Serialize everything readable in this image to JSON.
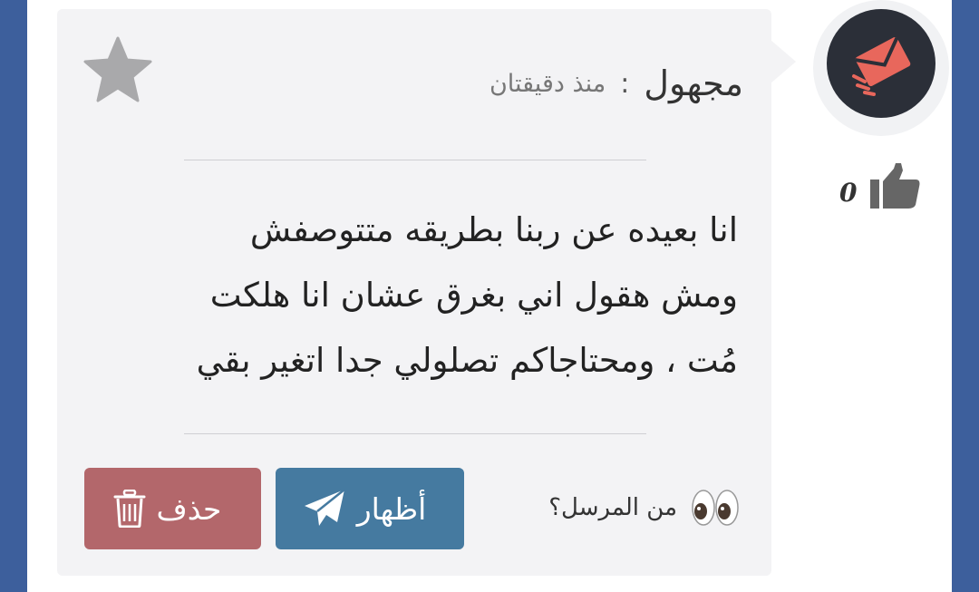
{
  "post": {
    "sender_name": "مجهول",
    "separator": ":",
    "time_ago": "منذ دقيقتان",
    "message_lines": [
      "انا بعيده عن ربنا بطريقه متتوصفش",
      "ومش هقول اني بغرق عشان انا هلكت",
      "مُت ، ومحتاجاكم تصلولي جدا اتغير بقي"
    ],
    "likes": "0",
    "actions": {
      "show_label": "أظهار",
      "delete_label": "حذف",
      "sender_question": "من المرسل؟"
    }
  },
  "colors": {
    "page_background": "#3d5f9c",
    "card_background": "#f3f3f5",
    "show_button": "#457aa0",
    "delete_button": "#b3676b",
    "avatar_background": "#2b2f38",
    "avatar_icon": "#e8675c"
  },
  "icons": {
    "avatar": "envelope-icon",
    "favorite": "star-icon",
    "like": "thumbs-up-icon",
    "show": "paper-plane-icon",
    "delete": "trash-icon",
    "sender": "eyes-icon"
  }
}
